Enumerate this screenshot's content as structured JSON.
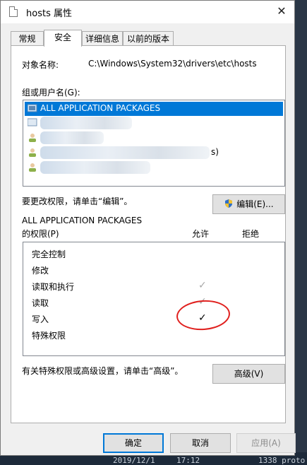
{
  "window": {
    "title": "hosts 属性",
    "close_glyph": "✕"
  },
  "tabs": [
    {
      "label": "常规"
    },
    {
      "label": "安全"
    },
    {
      "label": "详细信息"
    },
    {
      "label": "以前的版本"
    }
  ],
  "security": {
    "object_name_label": "对象名称:",
    "object_name_value": "C:\\Windows\\System32\\drivers\\etc\\hosts",
    "group_label": "组或用户名(G):",
    "users": [
      {
        "name": "ALL APPLICATION PACKAGES",
        "selected": true,
        "icon": "group-icon"
      },
      {
        "name": "",
        "blurred": true,
        "icon": "group-icon"
      },
      {
        "name": "",
        "blurred": true,
        "icon": "user-icon"
      },
      {
        "name": "",
        "blurred": true,
        "suffix": "s)",
        "icon": "user-icon"
      },
      {
        "name": "",
        "blurred": true,
        "icon": "user-icon"
      }
    ],
    "change_hint": "要更改权限，请单击“编辑”。",
    "edit_button": "编辑(E)...",
    "perm_subject": "ALL APPLICATION PACKAGES",
    "perm_label": "的权限(P)",
    "allow_header": "允许",
    "deny_header": "拒绝",
    "permissions": [
      {
        "name": "完全控制",
        "allow": false
      },
      {
        "name": "修改",
        "allow": false
      },
      {
        "name": "读取和执行",
        "allow": true,
        "inherited": true
      },
      {
        "name": "读取",
        "allow": true,
        "inherited": true
      },
      {
        "name": "写入",
        "allow": true,
        "inherited": false
      },
      {
        "name": "特殊权限",
        "allow": false
      }
    ],
    "advanced_hint": "有关特殊权限或高级设置，请单击“高级”。",
    "advanced_button": "高级(V)"
  },
  "footer": {
    "ok": "确定",
    "cancel": "取消",
    "apply": "应用(A)"
  },
  "background": {
    "taskbar_date": "2019/12/1",
    "taskbar_time": "17:12",
    "taskbar_info": "1338 proto"
  },
  "colors": {
    "selection": "#0078d7",
    "annotation_circle": "#e0201e"
  }
}
